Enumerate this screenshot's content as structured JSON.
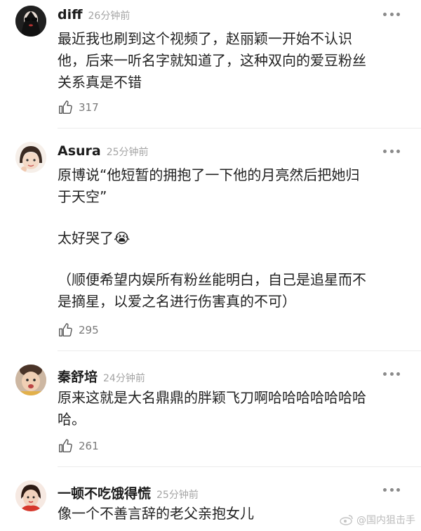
{
  "comments": [
    {
      "author": "diff",
      "time": "26分钟前",
      "lines": [
        "最近我也刷到这个视频了，赵丽颖一开始不认识",
        "他，后来一听名字就知道了，这种双向的爱豆粉丝",
        "关系真是不错"
      ],
      "likes": "317",
      "avatar_icon": "dark-portrait-avatar"
    },
    {
      "author": "Asura",
      "time": "25分钟前",
      "lines": [
        "原博说“他短暂的拥抱了一下他的月亮然后把她归",
        "于天空”",
        "",
        "太好哭了😭",
        "",
        "（顺便希望内娱所有粉丝能明白，自己是追星而不",
        "是摘星，以爱之名进行伤害真的不可）"
      ],
      "likes": "295",
      "avatar_icon": "girl-cartoon-avatar"
    },
    {
      "author": "秦舒培",
      "time": "24分钟前",
      "lines": [
        "原来这就是大名鼎鼎的胖颖飞刀啊哈哈哈哈哈哈哈",
        "哈。"
      ],
      "likes": "261",
      "avatar_icon": "child-photo-avatar"
    },
    {
      "author": "一顿不吃饿得慌",
      "time": "25分钟前",
      "lines": [
        "像一个不善言辞的老父亲抱女儿"
      ],
      "likes": "",
      "avatar_icon": "girl-red-avatar"
    }
  ],
  "watermark": "@国内狙击手",
  "colors": {
    "text": "#222222",
    "meta": "#a4a4a4",
    "divider": "#ececec"
  }
}
